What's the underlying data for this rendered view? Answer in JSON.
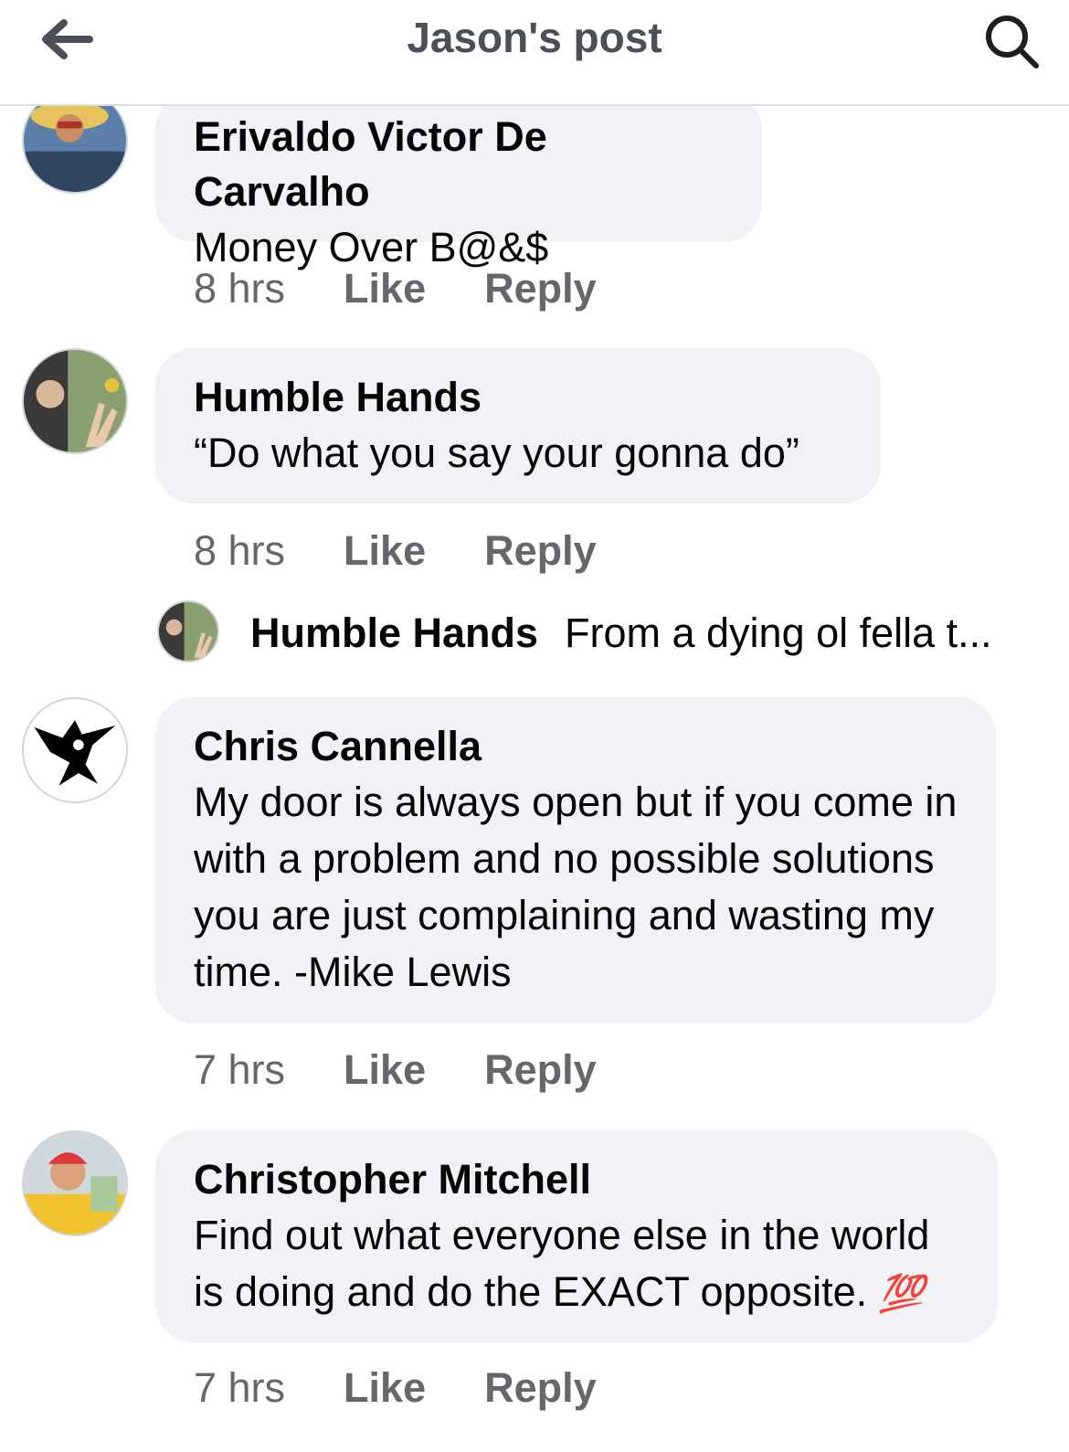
{
  "header": {
    "title": "Jason's post",
    "back_icon": "arrow-left-icon",
    "search_icon": "search-icon"
  },
  "comments": [
    {
      "author": "Erivaldo Victor De Carvalho",
      "text": "Money Over B@&$",
      "time": "8 hrs",
      "like_label": "Like",
      "reply_label": "Reply"
    },
    {
      "author": "Humble Hands",
      "text": "“Do what you say your gonna do”",
      "time": "8 hrs",
      "like_label": "Like",
      "reply_label": "Reply",
      "reply_preview": {
        "author": "Humble Hands",
        "text": "From a dying ol fella t..."
      }
    },
    {
      "author": "Chris Cannella",
      "text": "My door is always open but if you come in with a problem and no possible solutions you are just complaining and wasting my time. -Mike Lewis",
      "time": "7 hrs",
      "like_label": "Like",
      "reply_label": "Reply"
    },
    {
      "author": "Christopher Mitchell",
      "text": "Find out what everyone else in the world is doing and do the EXACT opposite.",
      "emoji": "💯",
      "time": "7 hrs",
      "like_label": "Like",
      "reply_label": "Reply"
    }
  ],
  "colors": {
    "bubble": "#f0f2f5",
    "secondary_text": "#65676b",
    "primary_text": "#050505",
    "hundred_emoji": "#e0245e"
  }
}
